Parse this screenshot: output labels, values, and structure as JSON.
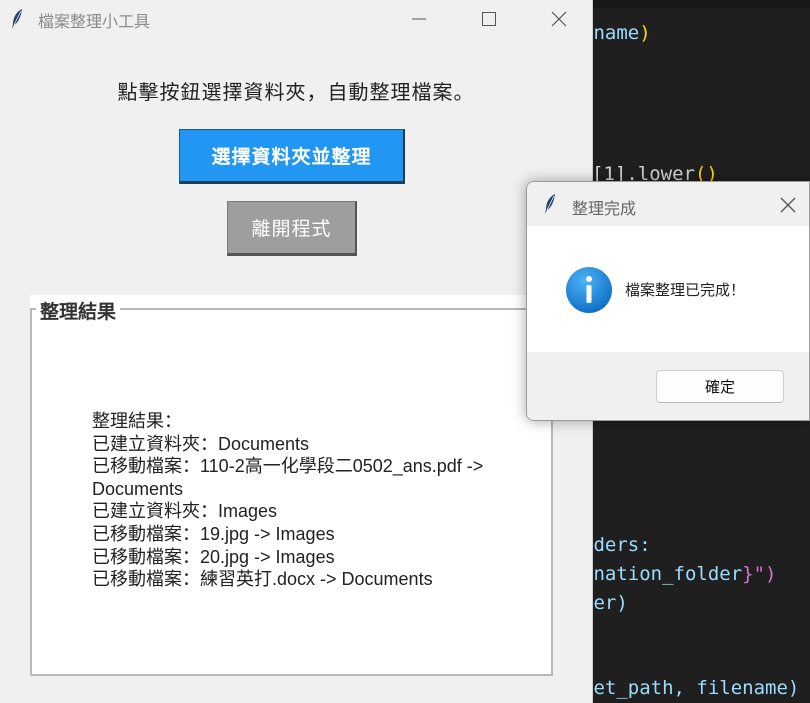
{
  "main_window": {
    "title": "檔案整理小工具",
    "instruction": "點擊按鈕選擇資料夾，自動整理檔案。",
    "select_button": "選擇資料夾並整理",
    "exit_button": "離開程式",
    "result_group": {
      "legend": "整理結果",
      "lines": [
        "整理結果：",
        "已建立資料夾：Documents",
        "已移動檔案：110-2高一化學段二0502_ans.pdf ->",
        "Documents",
        "已建立資料夾：Images",
        "已移動檔案：19.jpg -> Images",
        "已移動檔案：20.jpg -> Images",
        "已移動檔案：練習英打.docx -> Documents"
      ]
    }
  },
  "dialog": {
    "title": "整理完成",
    "message": "檔案整理已完成！",
    "ok_button": "確定",
    "icon": "info-icon"
  },
  "editor": {
    "line_1": "ename",
    "line_2_a": "[1].lower",
    "line_2_b": "()",
    "line_3": "lders:",
    "line_4_a": "ination_folder",
    "line_4_b": "}\")",
    "line_5": "der)",
    "line_6": "get_path, filename)"
  },
  "colors": {
    "primary_button": "#2196f3",
    "exit_button": "#9e9e9e",
    "info_icon": "#1a8ad8",
    "editor_bg": "#1f1f1f"
  }
}
